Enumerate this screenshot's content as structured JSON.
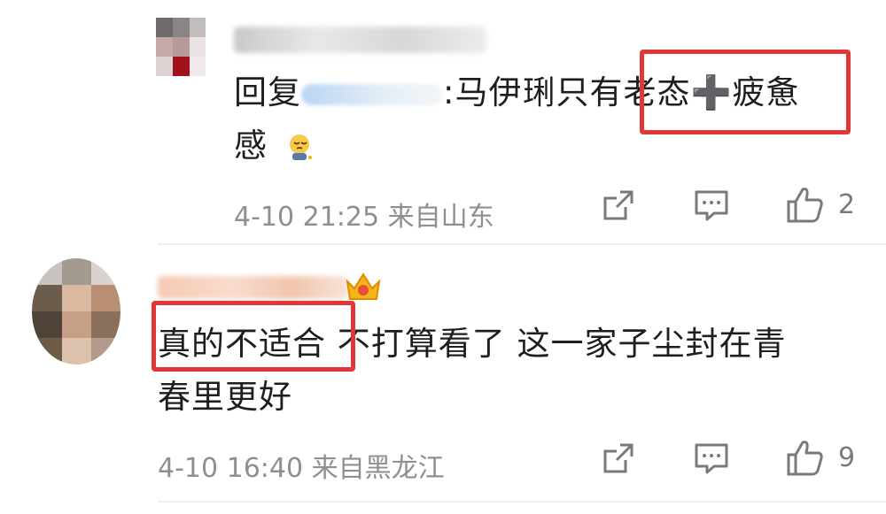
{
  "comments": [
    {
      "reply_prefix": "回复",
      "reply_suffix": ":马伊琍只有老态➕疲惫",
      "text_line2": "感",
      "emoji": "pensive-emoji",
      "meta": "4-10 21:25  来自山东",
      "likes": "2"
    },
    {
      "text_line1_highlight": "真的不适合",
      "text_line1_rest": " 不打算看了 这一家子尘封在青",
      "text_line2": "春里更好",
      "meta": "4-10 16:40  来自黑龙江",
      "likes": "9"
    }
  ],
  "colors": {
    "highlight_box": "#e0373b",
    "meta_text": "#8f8f8f",
    "icon": "#7a7a7a"
  },
  "icons": [
    "share-icon",
    "comment-icon",
    "like-icon",
    "vip-crown-icon"
  ]
}
